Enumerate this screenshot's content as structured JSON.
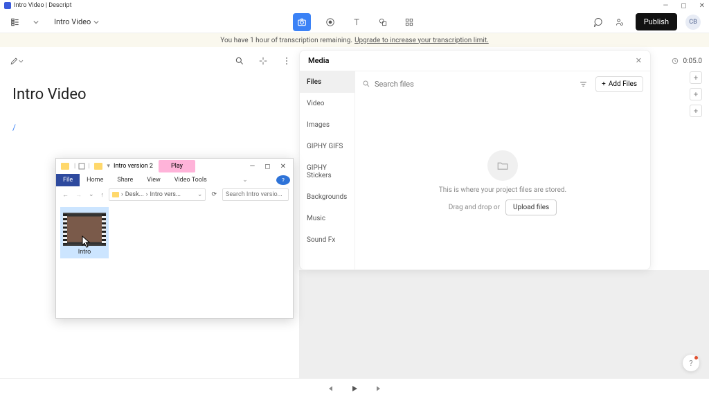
{
  "window": {
    "title": "Intro Video | Descript"
  },
  "toolbar": {
    "project_name": "Intro Video",
    "publish_label": "Publish",
    "avatar_initials": "CB"
  },
  "notice": {
    "text": "You have 1 hour of transcription remaining.",
    "link": "Upgrade to increase your transcription limit."
  },
  "editor": {
    "title": "Intro Video"
  },
  "timeline": {
    "duration": "0:05.0"
  },
  "media": {
    "title": "Media",
    "categories": [
      "Files",
      "Video",
      "Images",
      "GIPHY GIFS",
      "GIPHY Stickers",
      "Backgrounds",
      "Music",
      "Sound Fx"
    ],
    "active_index": 0,
    "search_placeholder": "Search files",
    "add_files_label": "Add Files",
    "empty_text": "This is where your project files are stored.",
    "drop_text": "Drag and drop or",
    "upload_label": "Upload files"
  },
  "explorer": {
    "title": "Intro version 2",
    "play_tab": "Play",
    "tabs": [
      "File",
      "Home",
      "Share",
      "View",
      "Video Tools"
    ],
    "active_tab_index": 0,
    "breadcrumbs": [
      "Desk...",
      "Intro vers..."
    ],
    "search_placeholder": "Search Intro versio...",
    "file_name": "Intro"
  }
}
